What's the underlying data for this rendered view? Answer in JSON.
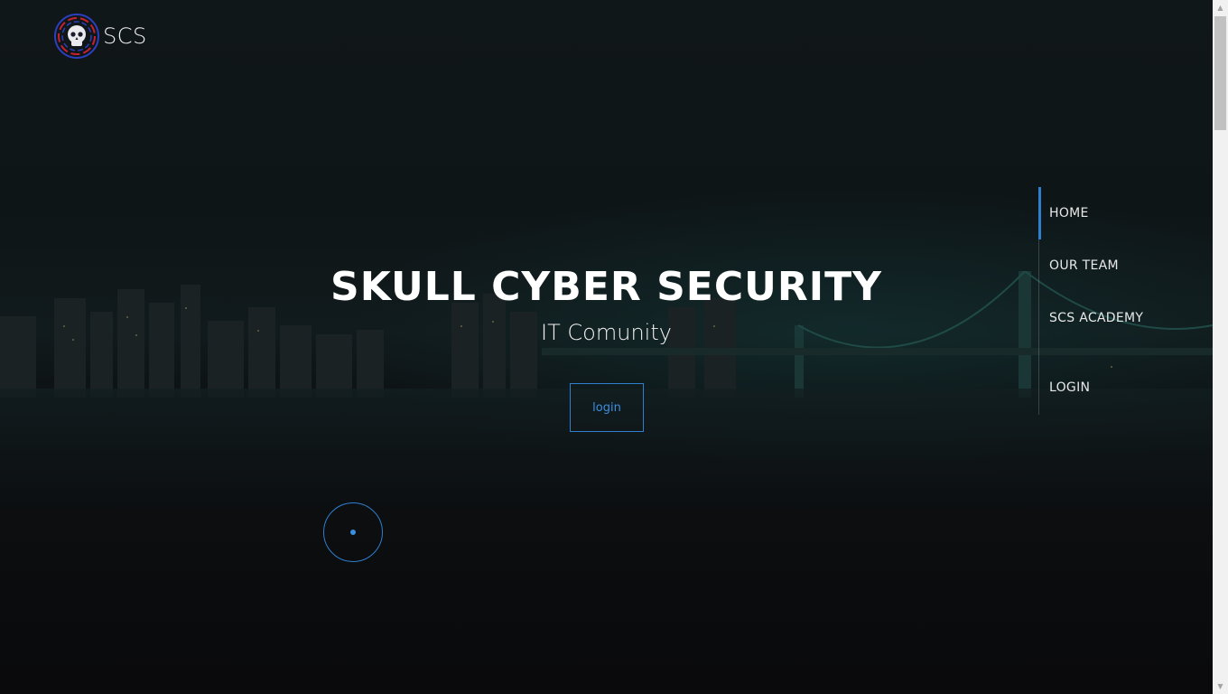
{
  "brand": {
    "name": "SCS",
    "logo_icon": "skull-icon",
    "colors": {
      "red": "#c8202f",
      "blue": "#2b3fbf"
    }
  },
  "hero": {
    "title": "SKULL CYBER SECURITY",
    "subtitle": "IT Comunity",
    "login_label": "login"
  },
  "nav": {
    "items": [
      {
        "label": "HOME",
        "active": true
      },
      {
        "label": "OUR TEAM",
        "active": false
      },
      {
        "label": "SCS ACADEMY",
        "active": false
      },
      {
        "label": "LOGIN",
        "active": false
      }
    ]
  },
  "theme": {
    "accent": "#2f7fcf",
    "background": "#0b0c0e",
    "text": "#ffffff"
  }
}
